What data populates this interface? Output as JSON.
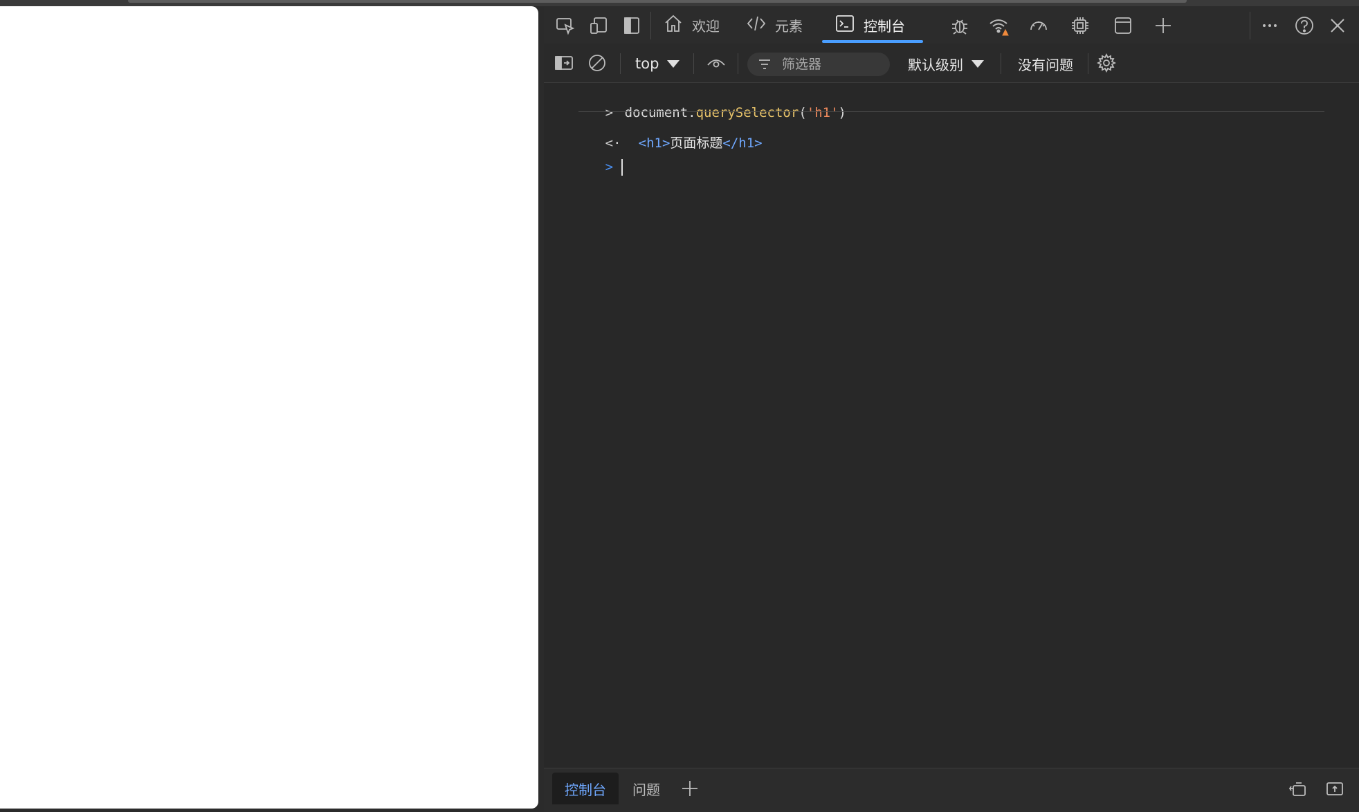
{
  "tabs": [
    {
      "label": "欢迎",
      "icon": "home-icon"
    },
    {
      "label": "元素",
      "icon": "code-icon"
    },
    {
      "label": "控制台",
      "icon": "console-icon",
      "active": true
    }
  ],
  "toolbar": {
    "context": "top",
    "filter_placeholder": "筛选器",
    "level": "默认级别",
    "issues": "没有问题"
  },
  "console": {
    "input": {
      "obj": "document.",
      "method": "querySelector",
      "open": "(",
      "arg": "'h1'",
      "close": ")"
    },
    "output": {
      "open_tag": "<h1>",
      "text": "页面标题",
      "close_tag": "</h1>"
    }
  },
  "drawer": {
    "tabs": [
      {
        "label": "控制台",
        "active": true
      },
      {
        "label": "问题"
      }
    ]
  },
  "colors": {
    "accent": "#4a9eff",
    "warning": "#f08a3c",
    "string": "#f08a5d",
    "method": "#e9c46a",
    "tag": "#6fa8ff"
  }
}
